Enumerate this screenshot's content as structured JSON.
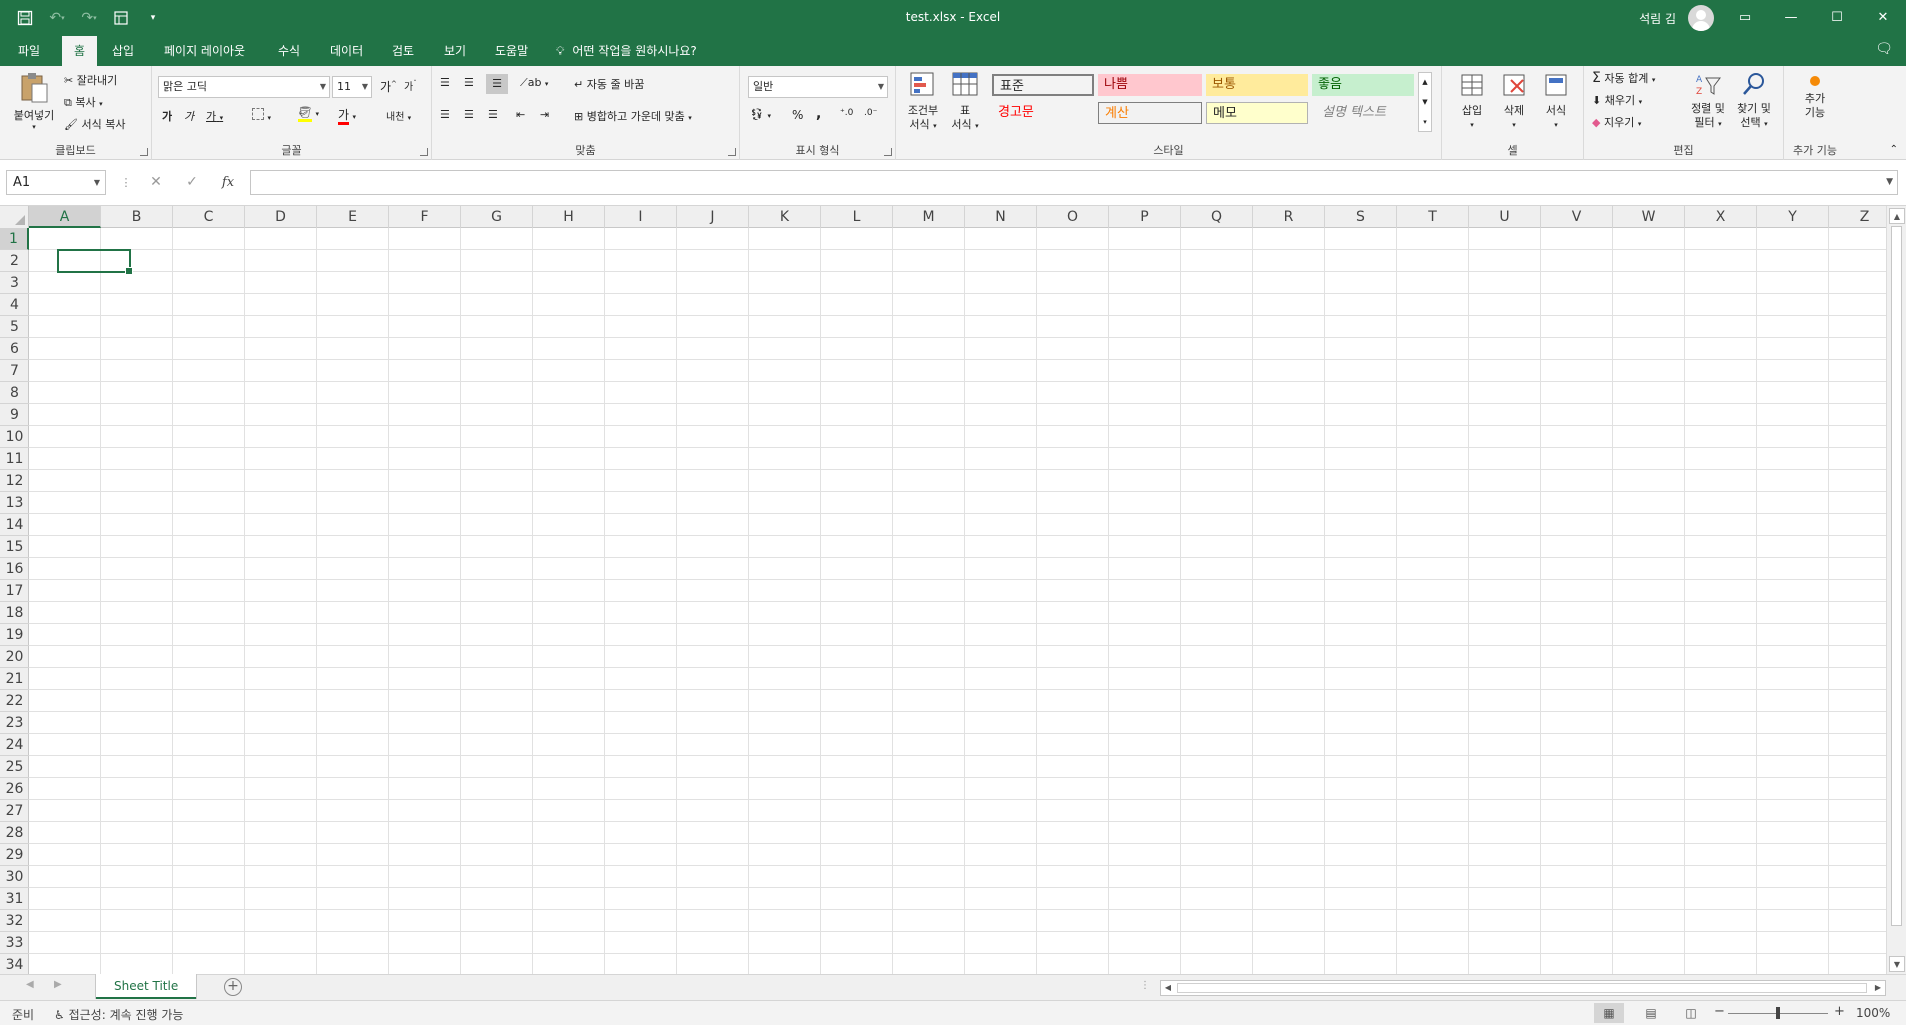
{
  "titlebar": {
    "title": "test.xlsx  -  Excel",
    "user": "석림 김",
    "icons": [
      "save-icon",
      "undo-icon",
      "redo-icon",
      "form-icon",
      "customize-qat-icon"
    ]
  },
  "tabs": [
    {
      "label": "파일"
    },
    {
      "label": "홈"
    },
    {
      "label": "삽입"
    },
    {
      "label": "페이지 레이아웃"
    },
    {
      "label": "수식"
    },
    {
      "label": "데이터"
    },
    {
      "label": "검토"
    },
    {
      "label": "보기"
    },
    {
      "label": "도움말"
    }
  ],
  "tellme": "어떤 작업을 원하시나요?",
  "ribbon": {
    "clipboard": {
      "label": "클립보드",
      "paste": "붙여넣기",
      "cut": "잘라내기",
      "copy": "복사",
      "format_painter": "서식 복사"
    },
    "font": {
      "label": "글꼴",
      "name": "맑은 고딕",
      "size": "11",
      "grow": "가",
      "shrink": "가",
      "bold": "가",
      "italic": "가",
      "underline": "가",
      "fontcolor": "가",
      "phonetic": "내천"
    },
    "alignment": {
      "label": "맞춤",
      "wrap": "자동 줄 바꿈",
      "merge": "병합하고 가운데 맞춤"
    },
    "number": {
      "label": "표시 형식",
      "format": "일반",
      "percent": "%",
      "comma": ","
    },
    "styles": {
      "label": "스타일",
      "conditional": [
        "조건부",
        "서식"
      ],
      "table": [
        "표",
        "서식"
      ],
      "cells": [
        {
          "text": "표준",
          "bg": "#ffffff",
          "color": "#000000"
        },
        {
          "text": "나쁨",
          "bg": "#ffc7ce",
          "color": "#9c0006"
        },
        {
          "text": "보통",
          "bg": "#ffeb9c",
          "color": "#9c5700"
        },
        {
          "text": "좋음",
          "bg": "#c6efce",
          "color": "#006100"
        },
        {
          "text": "경고문",
          "bg": "#f3f3f3",
          "color": "#ff0000"
        },
        {
          "text": "계산",
          "bg": "#f2f2f2",
          "color": "#fa7d00"
        },
        {
          "text": "메모",
          "bg": "#ffffcc",
          "color": "#000000"
        },
        {
          "text": "설명 텍스트",
          "bg": "#f3f3f3",
          "color": "#7f7f7f"
        }
      ]
    },
    "cells": {
      "label": "셀",
      "insert": "삽입",
      "delete": "삭제",
      "format": "서식"
    },
    "editing": {
      "label": "편집",
      "autosum": "자동 합계",
      "fill": "채우기",
      "clear": "지우기",
      "sort": [
        "정렬 및",
        "필터"
      ],
      "find": [
        "찾기 및",
        "선택"
      ]
    },
    "addins": {
      "label": "추가 기능",
      "btn": [
        "추가",
        "기능"
      ]
    }
  },
  "formulabar": {
    "namebox": "A1",
    "fx": "fx",
    "value": ""
  },
  "grid": {
    "columns": [
      "A",
      "B",
      "C",
      "D",
      "E",
      "F",
      "G",
      "H",
      "I",
      "J",
      "K",
      "L",
      "M",
      "N",
      "O",
      "P",
      "Q",
      "R",
      "S",
      "T",
      "U",
      "V",
      "W",
      "X",
      "Y",
      "Z"
    ],
    "rows": [
      1,
      2,
      3,
      4,
      5,
      6,
      7,
      8,
      9,
      10,
      11,
      12,
      13,
      14,
      15,
      16,
      17,
      18,
      19,
      20,
      21,
      22,
      23,
      24,
      25,
      26,
      27,
      28,
      29,
      30,
      31,
      32,
      33,
      34
    ],
    "active_cell": "A1"
  },
  "sheets": [
    {
      "name": "Sheet Title",
      "active": true
    }
  ],
  "statusbar": {
    "ready": "준비",
    "accessibility": "접근성: 계속 진행 가능",
    "zoom": "100%"
  },
  "colors": {
    "accent": "#217346",
    "ribbon_bg": "#f3f3f3"
  }
}
